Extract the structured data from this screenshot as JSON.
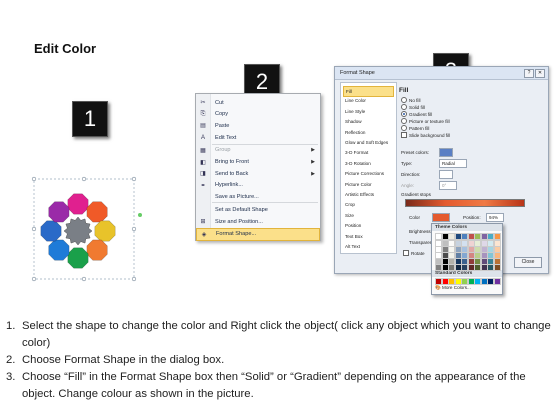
{
  "title": "Edit Color",
  "badges": [
    "1",
    "2",
    "3"
  ],
  "context_menu": {
    "items": [
      {
        "label": "Cut",
        "icon": "scissors-icon",
        "glyph": "✂",
        "enabled": true
      },
      {
        "label": "Copy",
        "icon": "copy-icon",
        "glyph": "⎘",
        "enabled": true
      },
      {
        "label": "Paste",
        "icon": "paste-icon",
        "glyph": "▤",
        "enabled": true
      },
      {
        "label": "Edit Text",
        "icon": "edit-text-icon",
        "glyph": "A",
        "enabled": true
      },
      {
        "label": "Group",
        "icon": "group-icon",
        "glyph": "▦",
        "enabled": false,
        "submenu": true
      },
      {
        "label": "Bring to Front",
        "icon": "bring-front-icon",
        "glyph": "◧",
        "enabled": true,
        "submenu": true
      },
      {
        "label": "Send to Back",
        "icon": "send-back-icon",
        "glyph": "◨",
        "enabled": true,
        "submenu": true
      },
      {
        "label": "Hyperlink...",
        "icon": "hyperlink-icon",
        "glyph": "⚭",
        "enabled": true
      },
      {
        "label": "Save as Picture...",
        "icon": "",
        "glyph": "",
        "enabled": true
      },
      {
        "label": "Set as Default Shape",
        "icon": "",
        "glyph": "",
        "enabled": true
      },
      {
        "label": "Size and Position...",
        "icon": "size-icon",
        "glyph": "⊞",
        "enabled": true
      },
      {
        "label": "Format Shape...",
        "icon": "format-shape-icon",
        "glyph": "◈",
        "enabled": true,
        "highlighted": true
      }
    ]
  },
  "format_dialog": {
    "title": "Format Shape",
    "close_label": "Close",
    "categories": [
      "Fill",
      "Line Color",
      "Line Style",
      "Shadow",
      "Reflection",
      "Glow and Soft Edges",
      "3-D Format",
      "3-D Rotation",
      "Picture Corrections",
      "Picture Color",
      "Artistic Effects",
      "Crop",
      "Size",
      "Position",
      "Text Box",
      "Alt Text"
    ],
    "selected_category": "Fill",
    "fill": {
      "heading": "Fill",
      "options": [
        {
          "label": "No fill",
          "selected": false
        },
        {
          "label": "Solid fill",
          "selected": false
        },
        {
          "label": "Gradient fill",
          "selected": true
        },
        {
          "label": "Picture or texture fill",
          "selected": false
        },
        {
          "label": "Pattern fill",
          "selected": false
        },
        {
          "label": "Slide background fill",
          "selected": false
        }
      ],
      "preset_colors_label": "Preset colors:",
      "type_label": "Type:",
      "type_value": "Radial",
      "direction_label": "Direction:",
      "angle_label": "Angle:",
      "angle_value": "0°",
      "gradient_stops_label": "Gradient stops",
      "color_label": "Color",
      "position_label": "Position:",
      "position_value": "94%",
      "brightness_label": "Brightness",
      "transparency_label": "Transparen",
      "rotate_label": "Rotate"
    }
  },
  "color_picker": {
    "theme_label": "Theme Colors",
    "standard_label": "Standard Colors",
    "more_label": "More Colors...",
    "theme_top": [
      "#ffffff",
      "#000000",
      "#eeece1",
      "#1f497d",
      "#4f81bd",
      "#c0504d",
      "#9bbb59",
      "#8064a2",
      "#4bacc6",
      "#f79646"
    ],
    "standard": [
      "#c00000",
      "#ff0000",
      "#ffc000",
      "#ffff00",
      "#92d050",
      "#00b050",
      "#00b0f0",
      "#0070c0",
      "#002060",
      "#7030a0"
    ]
  },
  "shape_colors": [
    "#e0208f",
    "#f05a28",
    "#e8c32a",
    "#f07a30",
    "#1aa04a",
    "#1e7bd8",
    "#2a6ac8",
    "#9a2aa8"
  ],
  "instructions": [
    {
      "num": "1.",
      "text": "Select the shape to change the color and Right click the object( click any object which you want to change color)"
    },
    {
      "num": "2.",
      "text": "Choose Format Shape in the dialog box."
    },
    {
      "num": "3.",
      "text": "Choose “Fill” in the Format Shape box then “Solid” or “Gradient” depending on the appearance of the object. Change colour as shown in the picture."
    }
  ]
}
